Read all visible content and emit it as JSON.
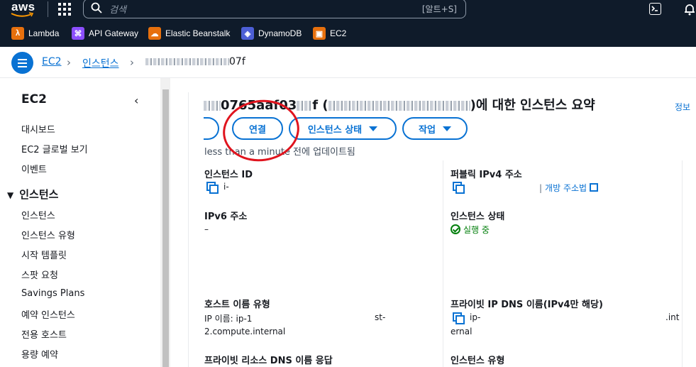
{
  "topbar": {
    "logo": "aws",
    "search_placeholder": "검색",
    "search_shortcut": "[알트+S]"
  },
  "favorites": [
    {
      "label": "Lambda",
      "icon": "lambda-icon",
      "color": "#e7700d"
    },
    {
      "label": "API Gateway",
      "icon": "api-gateway-icon",
      "color": "#8c4fff"
    },
    {
      "label": "Elastic Beanstalk",
      "icon": "elastic-beanstalk-icon",
      "color": "#e7700d"
    },
    {
      "label": "DynamoDB",
      "icon": "dynamodb-icon",
      "color": "#4d5fd6"
    },
    {
      "label": "EC2",
      "icon": "ec2-icon",
      "color": "#e7700d"
    }
  ],
  "breadcrumb": {
    "items": [
      "EC2",
      "인스턴스"
    ],
    "current_suffix": "07f"
  },
  "sidebar": {
    "title": "EC2",
    "top_items": [
      "대시보드",
      "EC2 글로벌 보기",
      "이벤트"
    ],
    "section": "인스턴스",
    "section_items": [
      "인스턴스",
      "인스턴스 유형",
      "시작 템플릿",
      "스팟 요청",
      "Savings Plans",
      "예약 인스턴스",
      "전용 호스트",
      "용량 예약"
    ]
  },
  "main": {
    "title_fragment": "0765aaf03",
    "title_fragment2": "f (",
    "title_tail": ")에 대한 인스턴스 요약",
    "info_link": "정보",
    "buttons": {
      "connect": "연결",
      "instance_state": "인스턴스 상태",
      "actions": "작업"
    },
    "updated": "less than a minute 전에 업데이트됨",
    "fields": {
      "instance_id_label": "인스턴스 ID",
      "instance_id_value": "i-",
      "public_ipv4_label": "퍼블릭 IPv4 주소",
      "open_address": "개방 주소법",
      "ipv6_label": "IPv6 주소",
      "ipv6_value": "–",
      "instance_state_label": "인스턴스 상태",
      "instance_state_value": "실행 중",
      "hostname_type_label": "호스트 이름 유형",
      "hostname_type_value1": "IP 이름: ip-1",
      "hostname_type_value1_tail": "st-",
      "hostname_type_value2": "2.compute.internal",
      "private_dns_label": "프라이빗 IP DNS 이름(IPv4만 해당)",
      "private_dns_value1": "ip-",
      "private_dns_value1_tail": ".int",
      "private_dns_value2": "ernal",
      "private_resource_dns_label": "프라이빗 리소스 DNS 이름 응답",
      "instance_type_label": "인스턴스 유형"
    }
  },
  "colors": {
    "accent": "#0972d3",
    "topbar": "#0f1b2a",
    "success": "#037f0c",
    "annotation": "#e0141e"
  }
}
